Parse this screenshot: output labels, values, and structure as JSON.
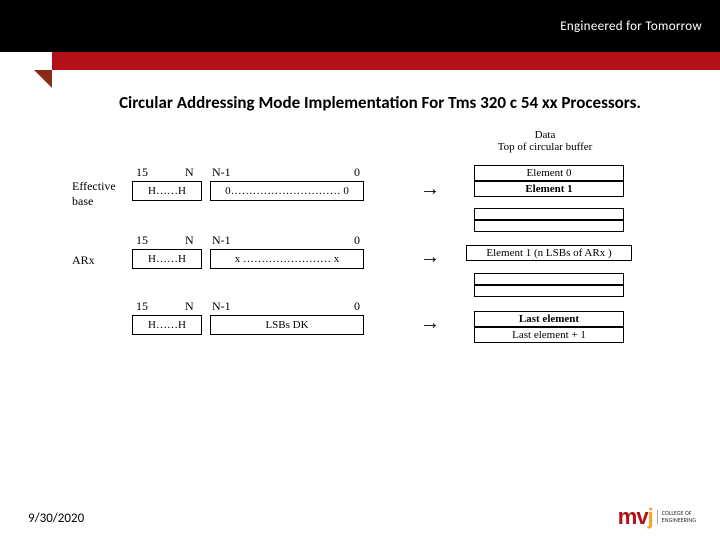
{
  "header": {
    "tagline": "Engineered for Tomorrow"
  },
  "title": "Circular Addressing Mode Implementation For Tms 320 c 54 xx Processors.",
  "diagram": {
    "col_labels": {
      "a": "15",
      "b": "N",
      "c": "N-1",
      "d": "0"
    },
    "rows": [
      {
        "label_line1": "Effective",
        "label_line2": "base",
        "left_box": "H……H",
        "right_box": "0………………………… 0"
      },
      {
        "label_line1": "ARx",
        "label_line2": "",
        "left_box": "H……H",
        "right_box": "x …………………… x"
      },
      {
        "label_line1": "",
        "label_line2": "",
        "left_box": "H……H",
        "right_box": "LSBs DK"
      }
    ],
    "data_header_line1": "Data",
    "data_header_line2": "Top of circular buffer",
    "data_stack": {
      "element0": "Element 0",
      "element1": "Element 1",
      "elementI": "Element 1  (n LSBs of ARx )",
      "last": "Last element",
      "last_plus1": "Last element + 1"
    }
  },
  "footer": {
    "date": "9/30/2020",
    "logo_text_line1": "COLLEGE OF",
    "logo_text_line2": "ENGINEERING"
  }
}
